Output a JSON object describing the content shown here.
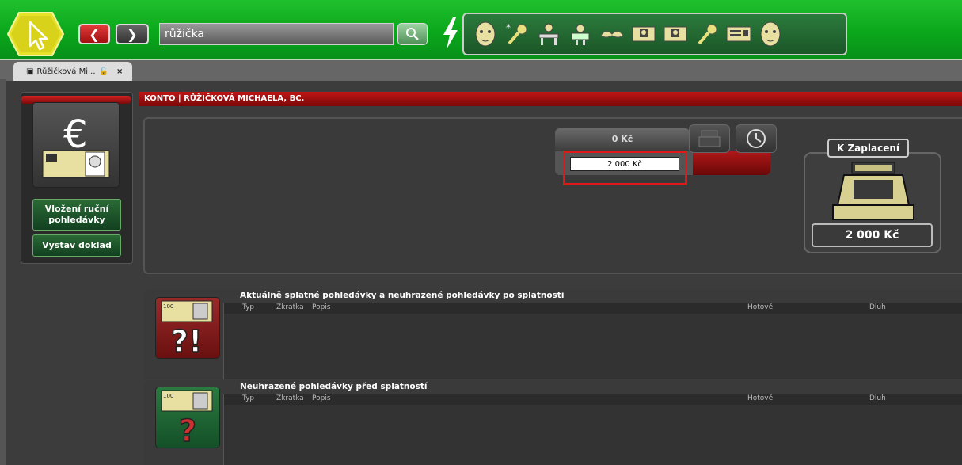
{
  "search": {
    "value": "růžička"
  },
  "tab": {
    "label": "Růžičková Mi...",
    "close": "×"
  },
  "sidebar": {
    "buttons": [
      {
        "label": "Vložení ruční pohledávky"
      },
      {
        "label": "Vystav doklad"
      }
    ]
  },
  "header": {
    "title": "KONTO | RŮŽIČKOVÁ MICHAELA, BC."
  },
  "payment": {
    "balance": "0 Kč",
    "amount_input": "2 000 Kč",
    "to_pay_label": "K Zaplacení",
    "to_pay_value": "2 000 Kč"
  },
  "sections": [
    {
      "title": "Aktuálně splatné pohledávky a neuhrazené pohledávky po splatnosti",
      "icon_text": "?!",
      "banknote": "100"
    },
    {
      "title": "Neuhrazené pohledávky před splatností",
      "icon_text": "?",
      "banknote": "100"
    }
  ],
  "columns": {
    "typ": "Typ",
    "zkratka": "Zkratka",
    "popis": "Popis",
    "hotove": "Hotově",
    "dluh": "Dluh"
  },
  "icons": [
    "pointer-icon",
    "back-arrow-icon",
    "forward-arrow-icon",
    "search-icon",
    "lightning-icon",
    "person-face-icon",
    "key-star-icon",
    "desk-person-icon",
    "bed-person-icon",
    "mustache-icon",
    "id-card-icon",
    "id-card-icon",
    "key-icon",
    "card-reader-icon",
    "person-face-icon",
    "lock-icon",
    "euro-icon",
    "printer-icon",
    "clock-icon",
    "cash-register-icon"
  ],
  "colors": {
    "accent_green": "#0aa51a",
    "danger_red": "#c01515",
    "section1_icon": "#8a1a1a",
    "section2_icon": "#1e6a33"
  }
}
